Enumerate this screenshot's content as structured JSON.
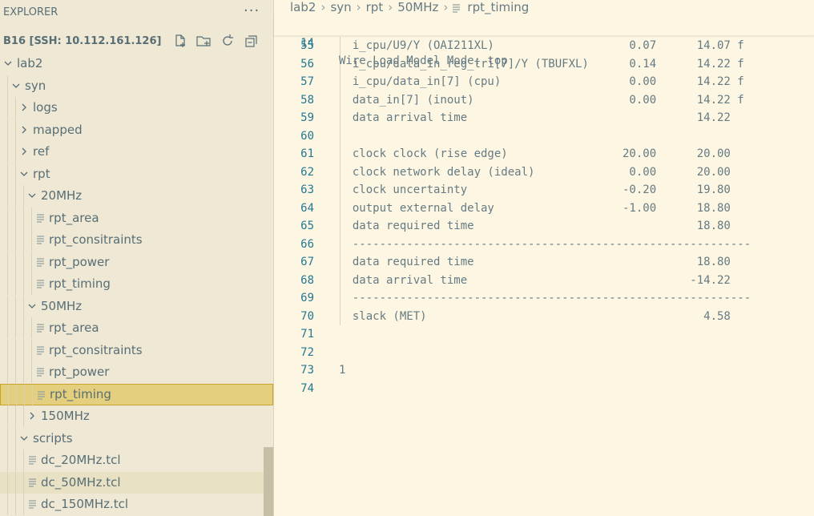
{
  "explorer": {
    "title": "EXPLORER",
    "more_label": "···",
    "workspace": "B16 [SSH: 10.112.161.126]",
    "actions": [
      "new-file-icon",
      "new-folder-icon",
      "refresh-icon",
      "collapse-all-icon"
    ]
  },
  "tree": [
    {
      "label": "lab2",
      "type": "folder",
      "expanded": true
    },
    {
      "label": "syn",
      "type": "folder",
      "expanded": true
    },
    {
      "label": "logs",
      "type": "folder",
      "expanded": false
    },
    {
      "label": "mapped",
      "type": "folder",
      "expanded": false
    },
    {
      "label": "ref",
      "type": "folder",
      "expanded": false
    },
    {
      "label": "rpt",
      "type": "folder",
      "expanded": true
    },
    {
      "label": "20MHz",
      "type": "folder",
      "expanded": true
    },
    {
      "label": "rpt_area",
      "type": "file"
    },
    {
      "label": "rpt_consitraints",
      "type": "file"
    },
    {
      "label": "rpt_power",
      "type": "file"
    },
    {
      "label": "rpt_timing",
      "type": "file"
    },
    {
      "label": "50MHz",
      "type": "folder",
      "expanded": true
    },
    {
      "label": "rpt_area",
      "type": "file"
    },
    {
      "label": "rpt_consitraints",
      "type": "file"
    },
    {
      "label": "rpt_power",
      "type": "file"
    },
    {
      "label": "rpt_timing",
      "type": "file",
      "selected": true
    },
    {
      "label": "150MHz",
      "type": "folder",
      "expanded": false
    },
    {
      "label": "scripts",
      "type": "folder",
      "expanded": true
    },
    {
      "label": "dc_20MHz.tcl",
      "type": "file"
    },
    {
      "label": "dc_50MHz.tcl",
      "type": "file",
      "hover": true
    },
    {
      "label": "dc_150MHz.tcl",
      "type": "file"
    }
  ],
  "breadcrumb": [
    "lab2",
    "syn",
    "rpt",
    "50MHz",
    "rpt_timing"
  ],
  "sticky_line": {
    "num": "14",
    "text": "Wire Load Model Mode: top"
  },
  "code": [
    {
      "num": "55",
      "text": "  i_cpu/U9/Y (OAI211XL)                    0.07      14.07 f"
    },
    {
      "num": "56",
      "text": "  i_cpu/data_in_reg_tri[7]/Y (TBUFXL)      0.14      14.22 f"
    },
    {
      "num": "57",
      "text": "  i_cpu/data_in[7] (cpu)                   0.00      14.22 f"
    },
    {
      "num": "58",
      "text": "  data_in[7] (inout)                       0.00      14.22 f"
    },
    {
      "num": "59",
      "text": "  data arrival time                                  14.22"
    },
    {
      "num": "60",
      "text": ""
    },
    {
      "num": "61",
      "text": "  clock clock (rise edge)                 20.00      20.00"
    },
    {
      "num": "62",
      "text": "  clock network delay (ideal)              0.00      20.00"
    },
    {
      "num": "63",
      "text": "  clock uncertainty                       -0.20      19.80"
    },
    {
      "num": "64",
      "text": "  output external delay                   -1.00      18.80"
    },
    {
      "num": "65",
      "text": "  data required time                                 18.80"
    },
    {
      "num": "66",
      "text": "  -----------------------------------------------------------"
    },
    {
      "num": "67",
      "text": "  data required time                                 18.80"
    },
    {
      "num": "68",
      "text": "  data arrival time                                 -14.22"
    },
    {
      "num": "69",
      "text": "  -----------------------------------------------------------"
    },
    {
      "num": "70",
      "text": "  slack (MET)                                         4.58"
    },
    {
      "num": "71",
      "text": ""
    },
    {
      "num": "72",
      "text": ""
    },
    {
      "num": "73",
      "text": "1"
    },
    {
      "num": "74",
      "text": ""
    }
  ]
}
